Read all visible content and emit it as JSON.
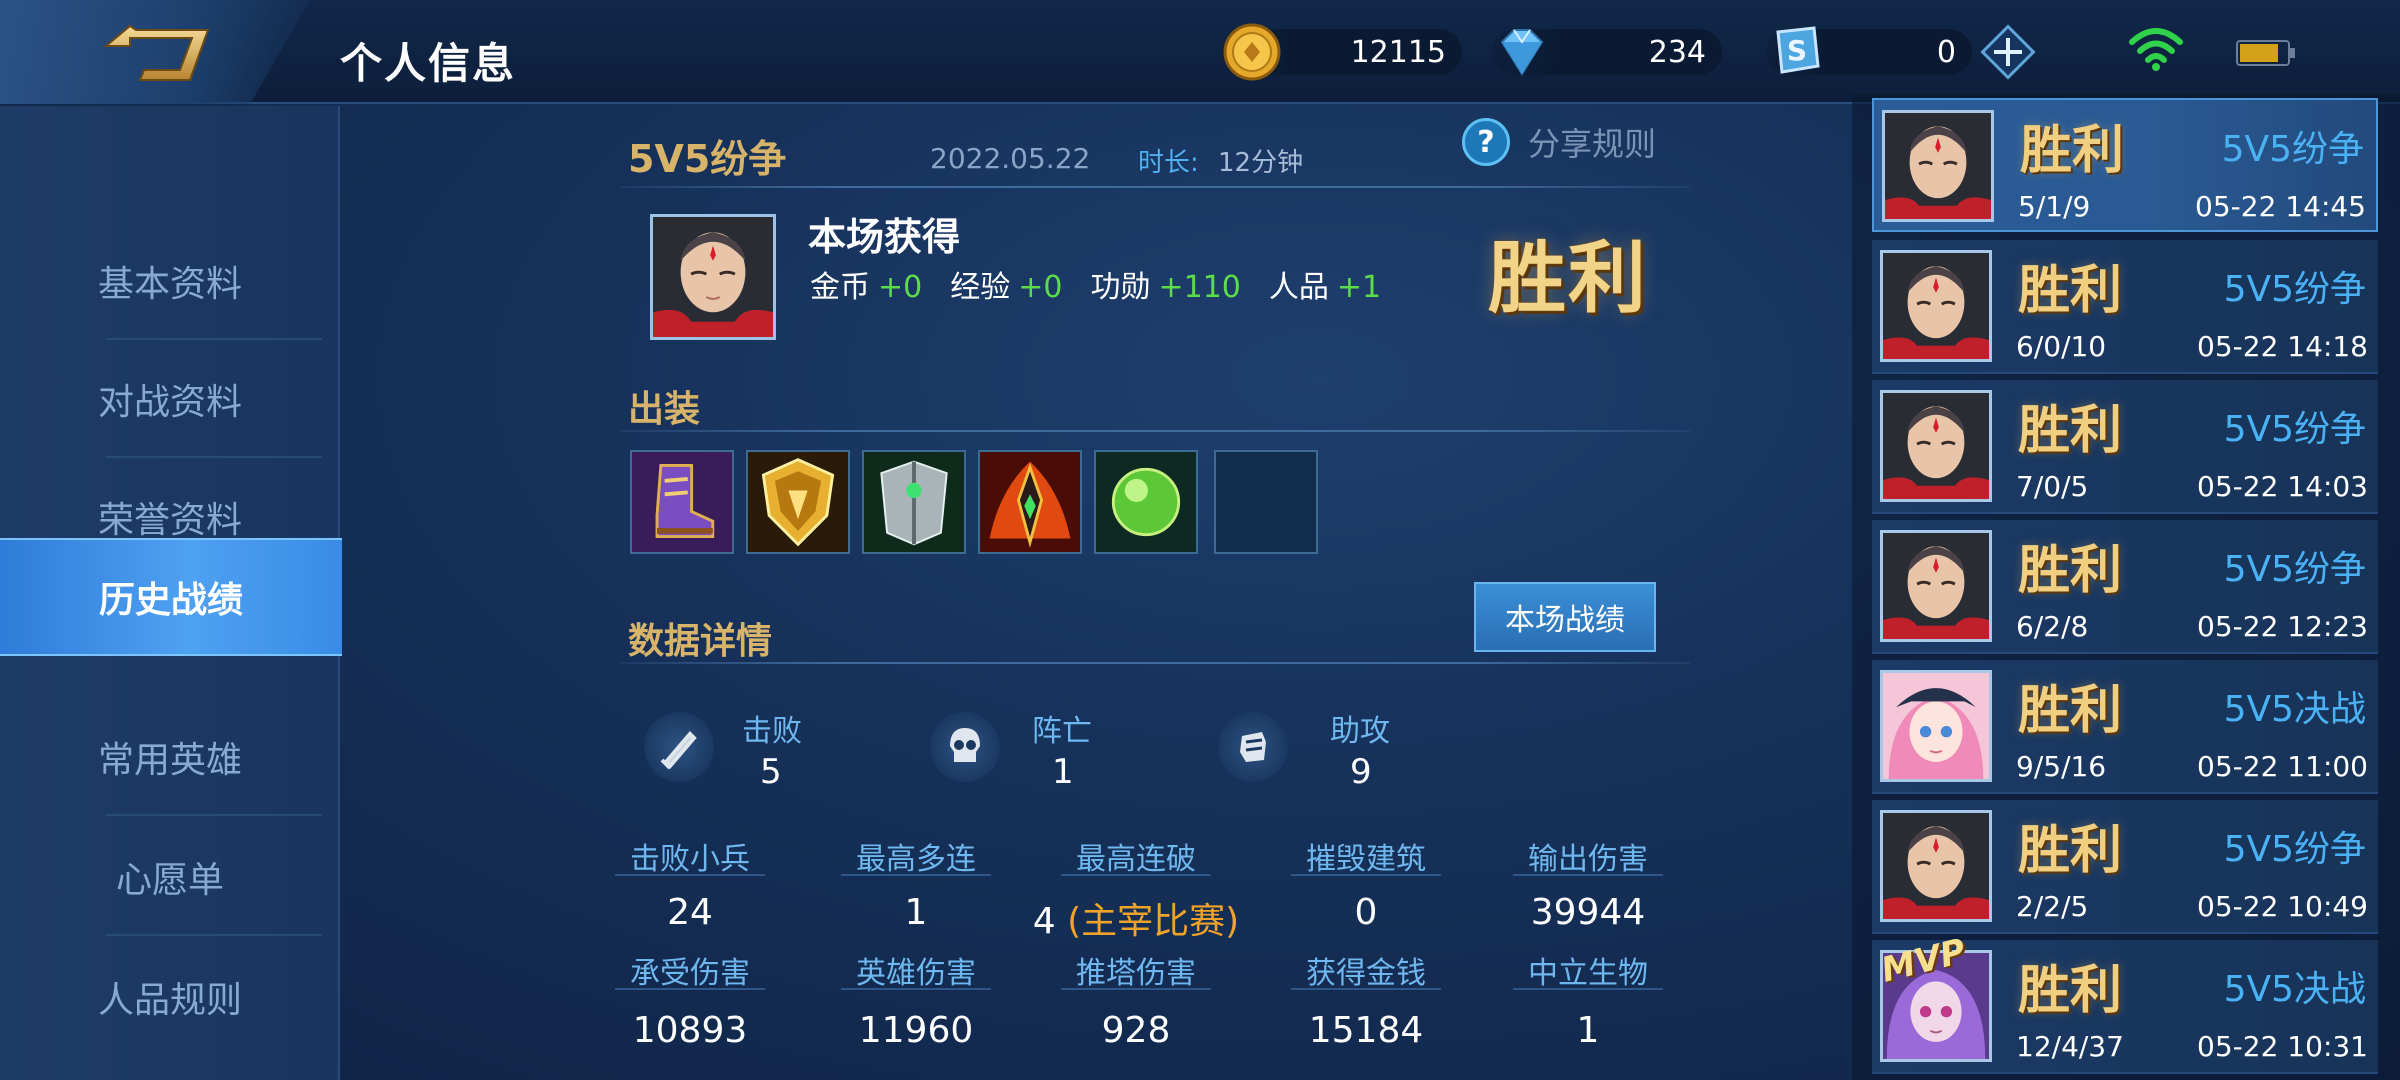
{
  "header": {
    "title": "个人信息",
    "gold": "12115",
    "diamonds": "234",
    "tokens": "0",
    "colors": {
      "accent": "#4fa1f2",
      "gold_text": "#d8b46a",
      "win": "#f2d489",
      "positive": "#5ddc4a"
    }
  },
  "sidebar": {
    "items": [
      {
        "label": "基本资料"
      },
      {
        "label": "对战资料"
      },
      {
        "label": "荣誉资料"
      },
      {
        "label": "历史战绩",
        "active": true
      },
      {
        "label": "常用英雄"
      },
      {
        "label": "心愿单"
      },
      {
        "label": "人品规则"
      }
    ]
  },
  "match": {
    "mode": "5V5纷争",
    "date": "2022.05.22",
    "duration_label": "时长:",
    "duration": "12分钟",
    "share_icon": "?",
    "share_label": "分享规则",
    "gains_title": "本场获得",
    "gains": [
      {
        "label": "金币",
        "value": "+0"
      },
      {
        "label": "经验",
        "value": "+0"
      },
      {
        "label": "功勋",
        "value": "+110"
      },
      {
        "label": "人品",
        "value": "+1"
      }
    ],
    "result": "胜利",
    "equip_title": "出装",
    "items": [
      "boots-item-icon",
      "shield-item-icon",
      "armor-item-icon",
      "sword-item-icon",
      "orb-item-icon",
      "empty-slot"
    ],
    "data_title": "数据详情",
    "battle_button": "本场战绩",
    "kda": [
      {
        "label": "击败",
        "value": "5",
        "icon": "sword-kill-icon"
      },
      {
        "label": "阵亡",
        "value": "1",
        "icon": "skull-icon"
      },
      {
        "label": "助攻",
        "value": "9",
        "icon": "fist-icon"
      }
    ],
    "stats_row1": [
      {
        "label": "击败小兵",
        "value": "24"
      },
      {
        "label": "最高多连",
        "value": "1"
      },
      {
        "label": "最高连破",
        "value": "4",
        "sub": "(主宰比赛)"
      },
      {
        "label": "摧毁建筑",
        "value": "0"
      },
      {
        "label": "输出伤害",
        "value": "39944"
      }
    ],
    "stats_row2": [
      {
        "label": "承受伤害",
        "value": "10893"
      },
      {
        "label": "英雄伤害",
        "value": "11960"
      },
      {
        "label": "推塔伤害",
        "value": "928"
      },
      {
        "label": "获得金钱",
        "value": "15184"
      },
      {
        "label": "中立生物",
        "value": "1"
      }
    ]
  },
  "history": [
    {
      "result": "胜利",
      "mode": "5V5纷争",
      "kda": "5/1/9",
      "time": "05-22 14:45",
      "hero": "monk"
    },
    {
      "result": "胜利",
      "mode": "5V5纷争",
      "kda": "6/0/10",
      "time": "05-22 14:18",
      "hero": "monk"
    },
    {
      "result": "胜利",
      "mode": "5V5纷争",
      "kda": "7/0/5",
      "time": "05-22 14:03",
      "hero": "monk"
    },
    {
      "result": "胜利",
      "mode": "5V5纷争",
      "kda": "6/2/8",
      "time": "05-22 12:23",
      "hero": "monk"
    },
    {
      "result": "胜利",
      "mode": "5V5决战",
      "kda": "9/5/16",
      "time": "05-22 11:00",
      "hero": "girl"
    },
    {
      "result": "胜利",
      "mode": "5V5纷争",
      "kda": "2/2/5",
      "time": "05-22 10:49",
      "hero": "monk"
    },
    {
      "result": "胜利",
      "mode": "5V5决战",
      "kda": "12/4/37",
      "time": "05-22 10:31",
      "hero": "purple",
      "mvp": "MVP"
    }
  ]
}
